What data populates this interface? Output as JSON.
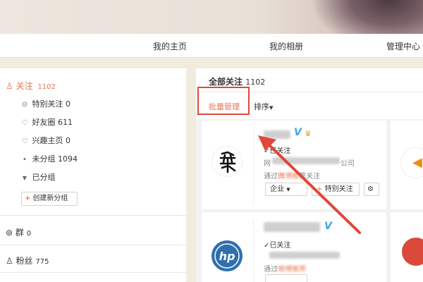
{
  "nav": {
    "items": [
      "我的主页",
      "我的相册",
      "管理中心"
    ]
  },
  "sidebar": {
    "follow": {
      "label": "关注",
      "count": "1102"
    },
    "items": [
      {
        "label": "特别关注",
        "count": "0"
      },
      {
        "label": "好友圈",
        "count": "611"
      },
      {
        "label": "兴趣主页",
        "count": "0"
      },
      {
        "label": "未分组",
        "count": "1094"
      },
      {
        "label": "已分组",
        "count": ""
      }
    ],
    "create_group": "创建新分组",
    "groups": {
      "label": "群",
      "count": "0"
    },
    "fans": {
      "label": "粉丝",
      "count": "775"
    }
  },
  "main": {
    "title": "全部关注",
    "count": "1102",
    "batch_manage": "批量管理",
    "sort": "排序"
  },
  "cards": [
    {
      "status": "已关注",
      "company_suffix": "公司",
      "source_prefix": "通过",
      "source_middle": "微",
      "source_suffix": "荐关注",
      "enterprise_btn": "企业",
      "special_btn": "特别关注"
    },
    {
      "status": "已关注",
      "source_prefix": "通过"
    }
  ],
  "colors": {
    "accent": "#eb7350",
    "arrow": "#e2463a",
    "verified": "#3aa3ec"
  }
}
